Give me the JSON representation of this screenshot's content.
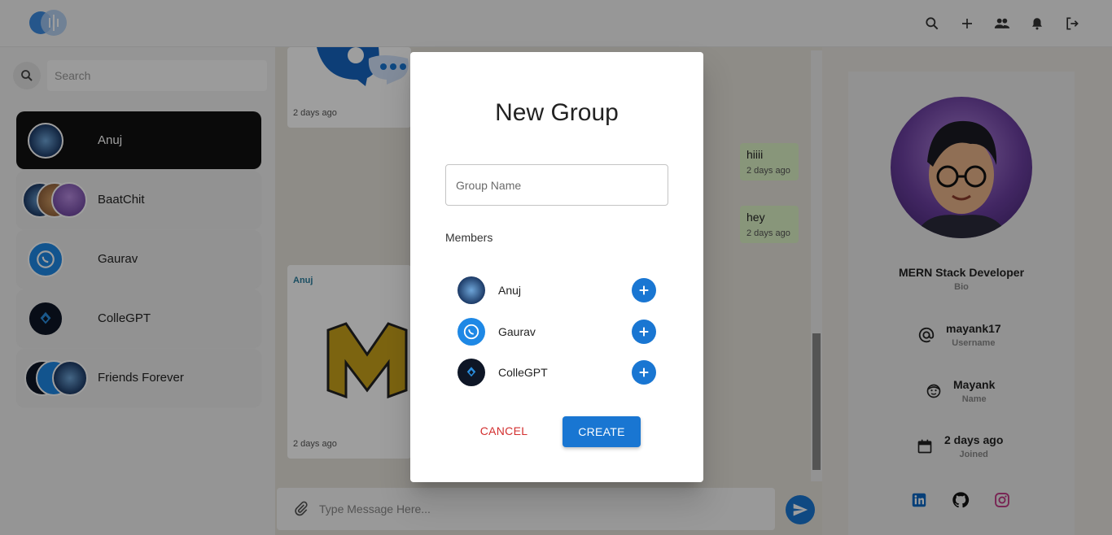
{
  "search": {
    "placeholder": "Search"
  },
  "chats": [
    {
      "name": "Anuj",
      "active": true
    },
    {
      "name": "BaatChit",
      "active": false
    },
    {
      "name": "Gaurav",
      "active": false
    },
    {
      "name": "ColleGPT",
      "active": false
    },
    {
      "name": "Friends Forever",
      "active": false
    }
  ],
  "messages": {
    "received_top_time": "2 days ago",
    "sent": [
      {
        "text": "hiiii",
        "time": "2 days ago"
      },
      {
        "text": "hey",
        "time": "2 days ago"
      }
    ],
    "received_image_sender": "Anuj",
    "received_image_time": "2 days ago"
  },
  "composer": {
    "placeholder": "Type Message Here..."
  },
  "profile": {
    "bio": "MERN Stack Developer",
    "bio_label": "Bio",
    "username": "mayank17",
    "username_label": "Username",
    "name": "Mayank",
    "name_label": "Name",
    "joined": "2 days ago",
    "joined_label": "Joined"
  },
  "dialog": {
    "title": "New Group",
    "group_name_placeholder": "Group Name",
    "members_label": "Members",
    "members": [
      {
        "name": "Anuj"
      },
      {
        "name": "Gaurav"
      },
      {
        "name": "ColleGPT"
      }
    ],
    "cancel_label": "CANCEL",
    "create_label": "CREATE"
  },
  "colors": {
    "primary": "#1976d2",
    "cancel": "#d32f2f",
    "active_chat": "#111111",
    "sent_bubble": "#dcf2c6"
  }
}
